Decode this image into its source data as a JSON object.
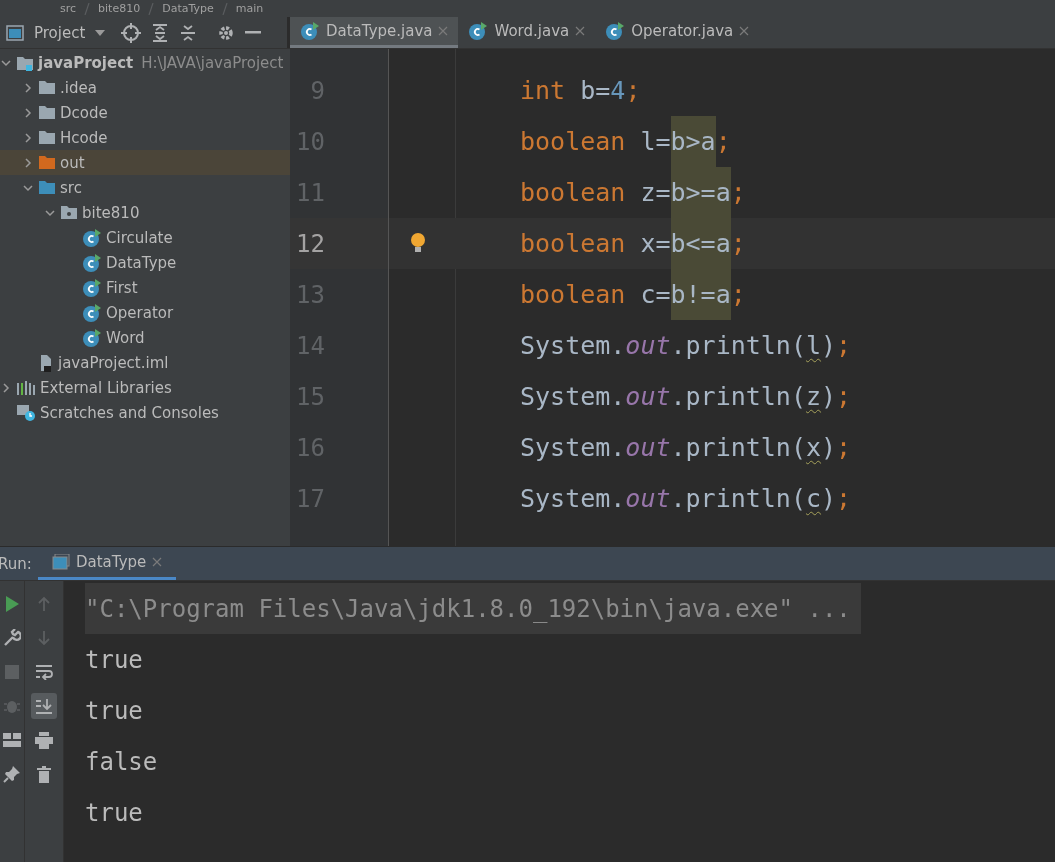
{
  "breadcrumb": [
    {
      "label": "src"
    },
    {
      "label": "bite810"
    },
    {
      "label": "DataType"
    },
    {
      "label": "main"
    }
  ],
  "project_panel": {
    "title": "Project"
  },
  "tree": [
    {
      "label": "javaProject",
      "detail": "H:\\JAVA\\javaProject",
      "kind": "module",
      "expanded": true,
      "selected": false,
      "children": [
        {
          "label": ".idea",
          "kind": "folder",
          "expanded": false,
          "selected": false
        },
        {
          "label": "Dcode",
          "kind": "folder",
          "expanded": false,
          "selected": false
        },
        {
          "label": "Hcode",
          "kind": "folder",
          "expanded": false,
          "selected": false
        },
        {
          "label": "out",
          "kind": "excluded",
          "expanded": false,
          "selected": true
        },
        {
          "label": "src",
          "kind": "source",
          "expanded": true,
          "selected": false,
          "children": [
            {
              "label": "bite810",
              "kind": "package",
              "expanded": true,
              "selected": false,
              "children": [
                {
                  "label": "Circulate",
                  "kind": "class",
                  "selected": false
                },
                {
                  "label": "DataType",
                  "kind": "class",
                  "selected": false
                },
                {
                  "label": "First",
                  "kind": "class",
                  "selected": false
                },
                {
                  "label": "Operator",
                  "kind": "class",
                  "selected": false
                },
                {
                  "label": "Word",
                  "kind": "class",
                  "selected": false
                }
              ]
            }
          ]
        },
        {
          "label": "javaProject.iml",
          "kind": "file",
          "selected": false
        }
      ]
    },
    {
      "label": "External Libraries",
      "kind": "libraries",
      "expanded": false,
      "selected": false
    },
    {
      "label": "Scratches and Consoles",
      "kind": "scratches",
      "selected": false
    }
  ],
  "editor_tabs": [
    {
      "label": "DataType.java",
      "selected": true
    },
    {
      "label": "Word.java",
      "selected": false
    },
    {
      "label": "Operator.java",
      "selected": false
    }
  ],
  "code_lines": [
    {
      "number": "9",
      "current": false,
      "tokens": [
        {
          "kind": "keyword",
          "text": "int",
          "highlighted": false
        },
        {
          "kind": "plain",
          "text": " b=",
          "highlighted": false
        },
        {
          "kind": "number",
          "text": "4",
          "highlighted": false
        },
        {
          "kind": "semi",
          "text": ";",
          "highlighted": false
        }
      ]
    },
    {
      "number": "10",
      "current": false,
      "tokens": [
        {
          "kind": "keyword",
          "text": "boolean",
          "highlighted": false
        },
        {
          "kind": "plain",
          "text": " l=",
          "highlighted": false
        },
        {
          "kind": "plain",
          "text": "b>a",
          "highlighted": true
        },
        {
          "kind": "semi",
          "text": ";",
          "highlighted": false
        }
      ]
    },
    {
      "number": "11",
      "current": false,
      "tokens": [
        {
          "kind": "keyword",
          "text": "boolean",
          "highlighted": false
        },
        {
          "kind": "plain",
          "text": " z=",
          "highlighted": false
        },
        {
          "kind": "plain",
          "text": "b>=a",
          "highlighted": true
        },
        {
          "kind": "semi",
          "text": ";",
          "highlighted": false
        }
      ]
    },
    {
      "number": "12",
      "current": true,
      "tokens": [
        {
          "kind": "keyword",
          "text": "boolean",
          "highlighted": false
        },
        {
          "kind": "plain",
          "text": " x=",
          "highlighted": false
        },
        {
          "kind": "plain",
          "text": "b<=a",
          "highlighted": true
        },
        {
          "kind": "semi",
          "text": ";",
          "highlighted": false
        }
      ]
    },
    {
      "number": "13",
      "current": false,
      "tokens": [
        {
          "kind": "keyword",
          "text": "boolean",
          "highlighted": false
        },
        {
          "kind": "plain",
          "text": " c=",
          "highlighted": false
        },
        {
          "kind": "plain",
          "text": "b!=a",
          "highlighted": true
        },
        {
          "kind": "semi",
          "text": ";",
          "highlighted": false
        }
      ]
    },
    {
      "number": "14",
      "current": false,
      "tokens": [
        {
          "kind": "plain",
          "text": "System.",
          "highlighted": false
        },
        {
          "kind": "field",
          "text": "out",
          "highlighted": false
        },
        {
          "kind": "plain",
          "text": ".println(",
          "highlighted": false
        },
        {
          "kind": "warned",
          "text": "l",
          "highlighted": false
        },
        {
          "kind": "plain",
          "text": ")",
          "highlighted": false
        },
        {
          "kind": "semi",
          "text": ";",
          "highlighted": false
        }
      ]
    },
    {
      "number": "15",
      "current": false,
      "tokens": [
        {
          "kind": "plain",
          "text": "System.",
          "highlighted": false
        },
        {
          "kind": "field",
          "text": "out",
          "highlighted": false
        },
        {
          "kind": "plain",
          "text": ".println(",
          "highlighted": false
        },
        {
          "kind": "warned",
          "text": "z",
          "highlighted": false
        },
        {
          "kind": "plain",
          "text": ")",
          "highlighted": false
        },
        {
          "kind": "semi",
          "text": ";",
          "highlighted": false
        }
      ]
    },
    {
      "number": "16",
      "current": false,
      "tokens": [
        {
          "kind": "plain",
          "text": "System.",
          "highlighted": false
        },
        {
          "kind": "field",
          "text": "out",
          "highlighted": false
        },
        {
          "kind": "plain",
          "text": ".println(",
          "highlighted": false
        },
        {
          "kind": "warned",
          "text": "x",
          "highlighted": false
        },
        {
          "kind": "plain",
          "text": ")",
          "highlighted": false
        },
        {
          "kind": "semi",
          "text": ";",
          "highlighted": false
        }
      ]
    },
    {
      "number": "17",
      "current": false,
      "tokens": [
        {
          "kind": "plain",
          "text": "System.",
          "highlighted": false
        },
        {
          "kind": "field",
          "text": "out",
          "highlighted": false
        },
        {
          "kind": "plain",
          "text": ".println(",
          "highlighted": false
        },
        {
          "kind": "warned",
          "text": "c",
          "highlighted": false
        },
        {
          "kind": "plain",
          "text": ")",
          "highlighted": false
        },
        {
          "kind": "semi",
          "text": ";",
          "highlighted": false
        }
      ]
    }
  ],
  "run_panel": {
    "label": "Run:",
    "tabs": [
      {
        "label": "DataType",
        "selected": true
      }
    ],
    "toolbar_main": [
      {
        "kind": "rerun",
        "disabled": false
      },
      {
        "kind": "settings",
        "disabled": false
      },
      {
        "kind": "stop",
        "disabled": true
      },
      {
        "kind": "debug",
        "disabled": true
      },
      {
        "kind": "layout",
        "disabled": false
      },
      {
        "kind": "pin",
        "disabled": false
      }
    ],
    "toolbar_console": [
      {
        "kind": "up",
        "disabled": true,
        "on": false
      },
      {
        "kind": "down",
        "disabled": true,
        "on": false
      },
      {
        "kind": "wrap",
        "disabled": false,
        "on": false
      },
      {
        "kind": "scroll-end",
        "disabled": false,
        "on": true
      },
      {
        "kind": "print",
        "disabled": false,
        "on": false
      },
      {
        "kind": "trash",
        "disabled": false,
        "on": false
      }
    ],
    "console_lines": [
      {
        "kind": "command",
        "text": "\"C:\\Program Files\\Java\\jdk1.8.0_192\\bin\\java.exe\" ..."
      },
      {
        "kind": "output",
        "text": "true"
      },
      {
        "kind": "output",
        "text": "true"
      },
      {
        "kind": "output",
        "text": "false"
      },
      {
        "kind": "output",
        "text": "true"
      }
    ]
  }
}
